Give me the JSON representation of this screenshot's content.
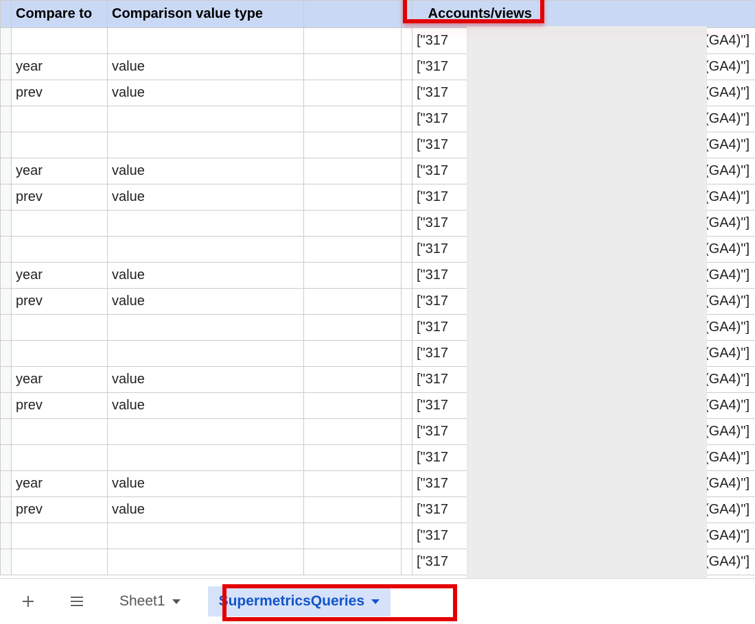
{
  "columns": {
    "compare_to": "Compare to",
    "comparison_value_type": "Comparison value type",
    "accounts_views": "Accounts/views"
  },
  "accounts_cell": {
    "prefix": "[\"317",
    "suffix": "(GA4)\"]"
  },
  "rows": [
    {
      "compare_to": "",
      "value_type": ""
    },
    {
      "compare_to": "year",
      "value_type": "value"
    },
    {
      "compare_to": "prev",
      "value_type": "value"
    },
    {
      "compare_to": "",
      "value_type": ""
    },
    {
      "compare_to": "",
      "value_type": ""
    },
    {
      "compare_to": "year",
      "value_type": "value"
    },
    {
      "compare_to": "prev",
      "value_type": "value"
    },
    {
      "compare_to": "",
      "value_type": ""
    },
    {
      "compare_to": "",
      "value_type": ""
    },
    {
      "compare_to": "year",
      "value_type": "value"
    },
    {
      "compare_to": "prev",
      "value_type": "value"
    },
    {
      "compare_to": "",
      "value_type": ""
    },
    {
      "compare_to": "",
      "value_type": ""
    },
    {
      "compare_to": "year",
      "value_type": "value"
    },
    {
      "compare_to": "prev",
      "value_type": "value"
    },
    {
      "compare_to": "",
      "value_type": ""
    },
    {
      "compare_to": "",
      "value_type": ""
    },
    {
      "compare_to": "year",
      "value_type": "value"
    },
    {
      "compare_to": "prev",
      "value_type": "value"
    },
    {
      "compare_to": "",
      "value_type": ""
    },
    {
      "compare_to": "",
      "value_type": ""
    }
  ],
  "tabs": {
    "add_label": "Add sheet",
    "all_label": "All sheets",
    "sheet1": "Sheet1",
    "supermetrics": "SupermetricsQueries"
  }
}
